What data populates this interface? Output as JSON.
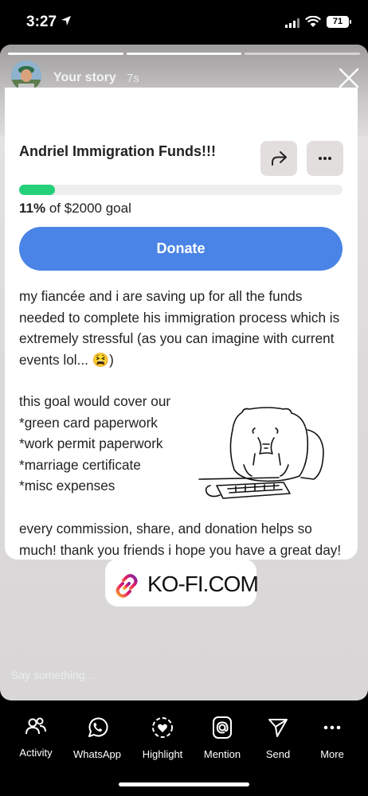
{
  "status_bar": {
    "time": "3:27",
    "battery": "71"
  },
  "story": {
    "user_label": "Your story",
    "age": "7s",
    "reply_placeholder": "Say something..."
  },
  "kofi": {
    "title": "Andriel Immigration Funds!!!",
    "progress_percent": 11,
    "goal_percent_text": "11%",
    "goal_text": " of $2000 goal",
    "donate_label": "Donate",
    "paragraph1": "my fiancée and i are saving up for all the funds needed to complete his immigration process which is extremely stressful (as you can imagine with current events lol... 😫)",
    "list_intro": "this goal would cover our",
    "list_items": [
      "*green card paperwork",
      "*work permit paperwork",
      "*marriage certificate",
      "*misc expenses"
    ],
    "paragraph3": "every commission, share, and donation helps so much! thank you friends i hope you have a great day!",
    "sticker_text": "KO-FI.COM"
  },
  "bottom_nav": [
    {
      "label": "Activity",
      "icon": "activity-icon"
    },
    {
      "label": "WhatsApp",
      "icon": "whatsapp-icon"
    },
    {
      "label": "Highlight",
      "icon": "highlight-icon"
    },
    {
      "label": "Mention",
      "icon": "mention-icon"
    },
    {
      "label": "Send",
      "icon": "send-icon"
    },
    {
      "label": "More",
      "icon": "more-icon"
    }
  ]
}
